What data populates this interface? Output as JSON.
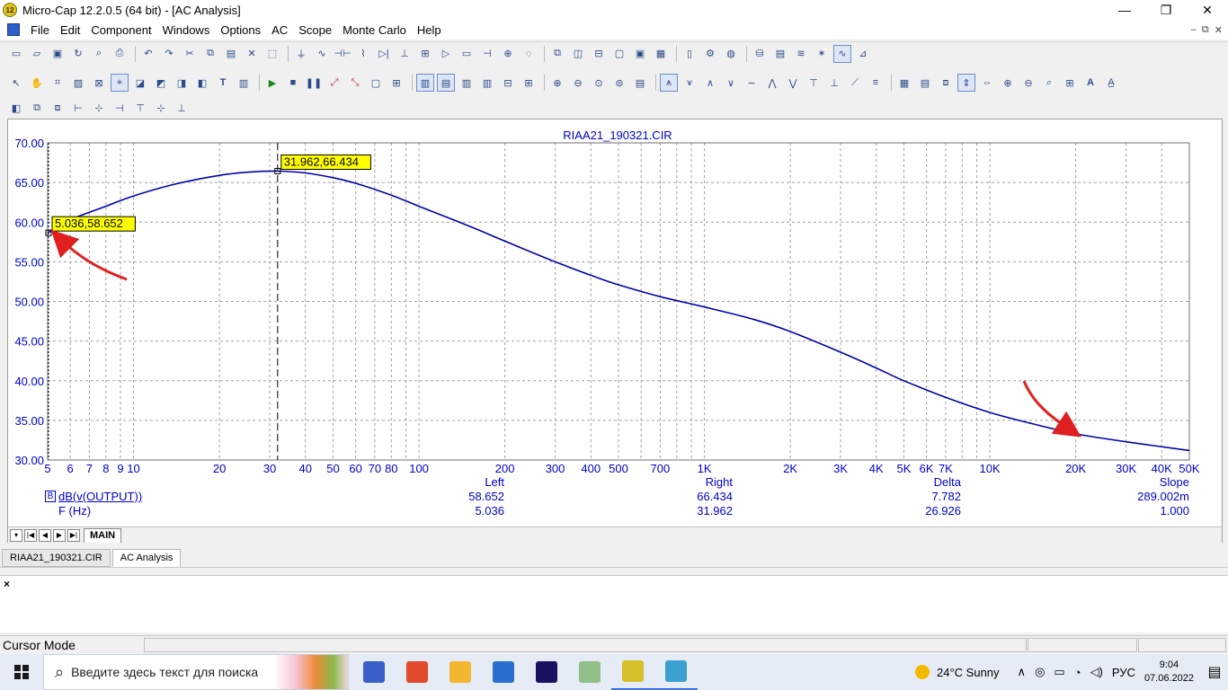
{
  "window": {
    "title": "Micro-Cap 12.2.0.5 (64 bit) - [AC Analysis]",
    "app_icon_text": "12",
    "minimize": "—",
    "maximize": "❐",
    "close": "✕"
  },
  "menu": [
    "File",
    "Edit",
    "Component",
    "Windows",
    "Options",
    "AC",
    "Scope",
    "Monte Carlo",
    "Help"
  ],
  "mdi_buttons": [
    "–",
    "⧉",
    "✕"
  ],
  "plot": {
    "title": "RIAA21_190321.CIR",
    "colors": {
      "trace": "#0000aa",
      "grid": "#a0a0a0",
      "axis_text": "#0000cc",
      "tag_bg": "#ffff00",
      "annotation": "#e02020"
    },
    "y_tick_labels": [
      "70.00",
      "65.00",
      "60.00",
      "55.00",
      "50.00",
      "45.00",
      "40.00",
      "35.00",
      "30.00"
    ],
    "x_tick_labels": [
      {
        "v": 5,
        "t": "5"
      },
      {
        "v": 6,
        "t": "6"
      },
      {
        "v": 7,
        "t": "7"
      },
      {
        "v": 8,
        "t": "8"
      },
      {
        "v": 9,
        "t": "9"
      },
      {
        "v": 10,
        "t": "10"
      },
      {
        "v": 20,
        "t": "20"
      },
      {
        "v": 30,
        "t": "30"
      },
      {
        "v": 40,
        "t": "40"
      },
      {
        "v": 50,
        "t": "50"
      },
      {
        "v": 60,
        "t": "60"
      },
      {
        "v": 70,
        "t": "70"
      },
      {
        "v": 80,
        "t": "80"
      },
      {
        "v": 100,
        "t": "100"
      },
      {
        "v": 200,
        "t": "200"
      },
      {
        "v": 300,
        "t": "300"
      },
      {
        "v": 400,
        "t": "400"
      },
      {
        "v": 500,
        "t": "500"
      },
      {
        "v": 700,
        "t": "700"
      },
      {
        "v": 1000,
        "t": "1K"
      },
      {
        "v": 2000,
        "t": "2K"
      },
      {
        "v": 3000,
        "t": "3K"
      },
      {
        "v": 4000,
        "t": "4K"
      },
      {
        "v": 5000,
        "t": "5K"
      },
      {
        "v": 6000,
        "t": "6K"
      },
      {
        "v": 7000,
        "t": "7K"
      },
      {
        "v": 10000,
        "t": "10K"
      },
      {
        "v": 20000,
        "t": "20K"
      },
      {
        "v": 30000,
        "t": "30K"
      },
      {
        "v": 40000,
        "t": "40K"
      },
      {
        "v": 50000,
        "t": "50K"
      }
    ],
    "cursor_left_tag": "5.036,58.652",
    "cursor_right_tag": "31.962,66.434"
  },
  "chart_data": {
    "type": "line",
    "title": "RIAA21_190321.CIR",
    "x_scale": "log",
    "xlim": [
      5,
      50000
    ],
    "ylim": [
      30,
      70
    ],
    "grid": true,
    "series": [
      {
        "name": "dB(v(OUTPUT))",
        "x": [
          5,
          6,
          8,
          10,
          14,
          20,
          25,
          31.962,
          40,
          50,
          60,
          80,
          100,
          150,
          200,
          300,
          400,
          500,
          700,
          1000,
          1500,
          2000,
          3000,
          4000,
          5000,
          7000,
          10000,
          14000,
          20000,
          30000,
          50000
        ],
        "y": [
          58.652,
          60.3,
          62.0,
          63.3,
          64.8,
          65.9,
          66.3,
          66.434,
          66.2,
          65.6,
          64.9,
          63.4,
          62.0,
          59.5,
          57.6,
          55.0,
          53.3,
          52.1,
          50.6,
          49.3,
          47.7,
          46.2,
          43.6,
          41.6,
          40.0,
          37.9,
          36.0,
          34.6,
          33.3,
          32.3,
          31.2
        ]
      }
    ],
    "cursors": [
      {
        "name": "left",
        "x": 5.036,
        "y": 58.652
      },
      {
        "name": "right",
        "x": 31.962,
        "y": 66.434
      }
    ]
  },
  "cursor_table": {
    "headers": {
      "left": "Left",
      "right": "Right",
      "delta": "Delta",
      "slope": "Slope"
    },
    "row1": {
      "marker": "B",
      "label": "dB(v(OUTPUT))",
      "left": "58.652",
      "right": "66.434",
      "delta": "7.782",
      "slope": "289.002m"
    },
    "row2": {
      "label": "F (Hz)",
      "left": "5.036",
      "right": "31.962",
      "delta": "26.926",
      "slope": "1.000"
    }
  },
  "bottom_tabs": {
    "nav": [
      "▾",
      "|◀",
      "◀",
      "▶",
      "▶|"
    ],
    "main": "MAIN"
  },
  "doc_tabs": [
    "RIAA21_190321.CIR",
    "AC Analysis"
  ],
  "output_close": "×",
  "status": {
    "mode": "Cursor Mode"
  },
  "taskbar": {
    "search_placeholder": "Введите здесь текст для поиска",
    "apps": [
      {
        "name": "save-app",
        "color": "#3a5fc8"
      },
      {
        "name": "chrome-app",
        "color": "#e04a2a"
      },
      {
        "name": "explorer-app",
        "color": "#f2b630"
      },
      {
        "name": "store-app",
        "color": "#2a6fd0"
      },
      {
        "name": "premiere-app",
        "color": "#1a1060"
      },
      {
        "name": "eraser-app",
        "color": "#8fc08a"
      },
      {
        "name": "microcap-app",
        "color": "#d8c02a"
      },
      {
        "name": "pen-app",
        "color": "#3aa0d0"
      }
    ],
    "weather": "24°C  Sunny",
    "lang": "РУС",
    "time": "9:04",
    "date": "07.06.2022"
  }
}
